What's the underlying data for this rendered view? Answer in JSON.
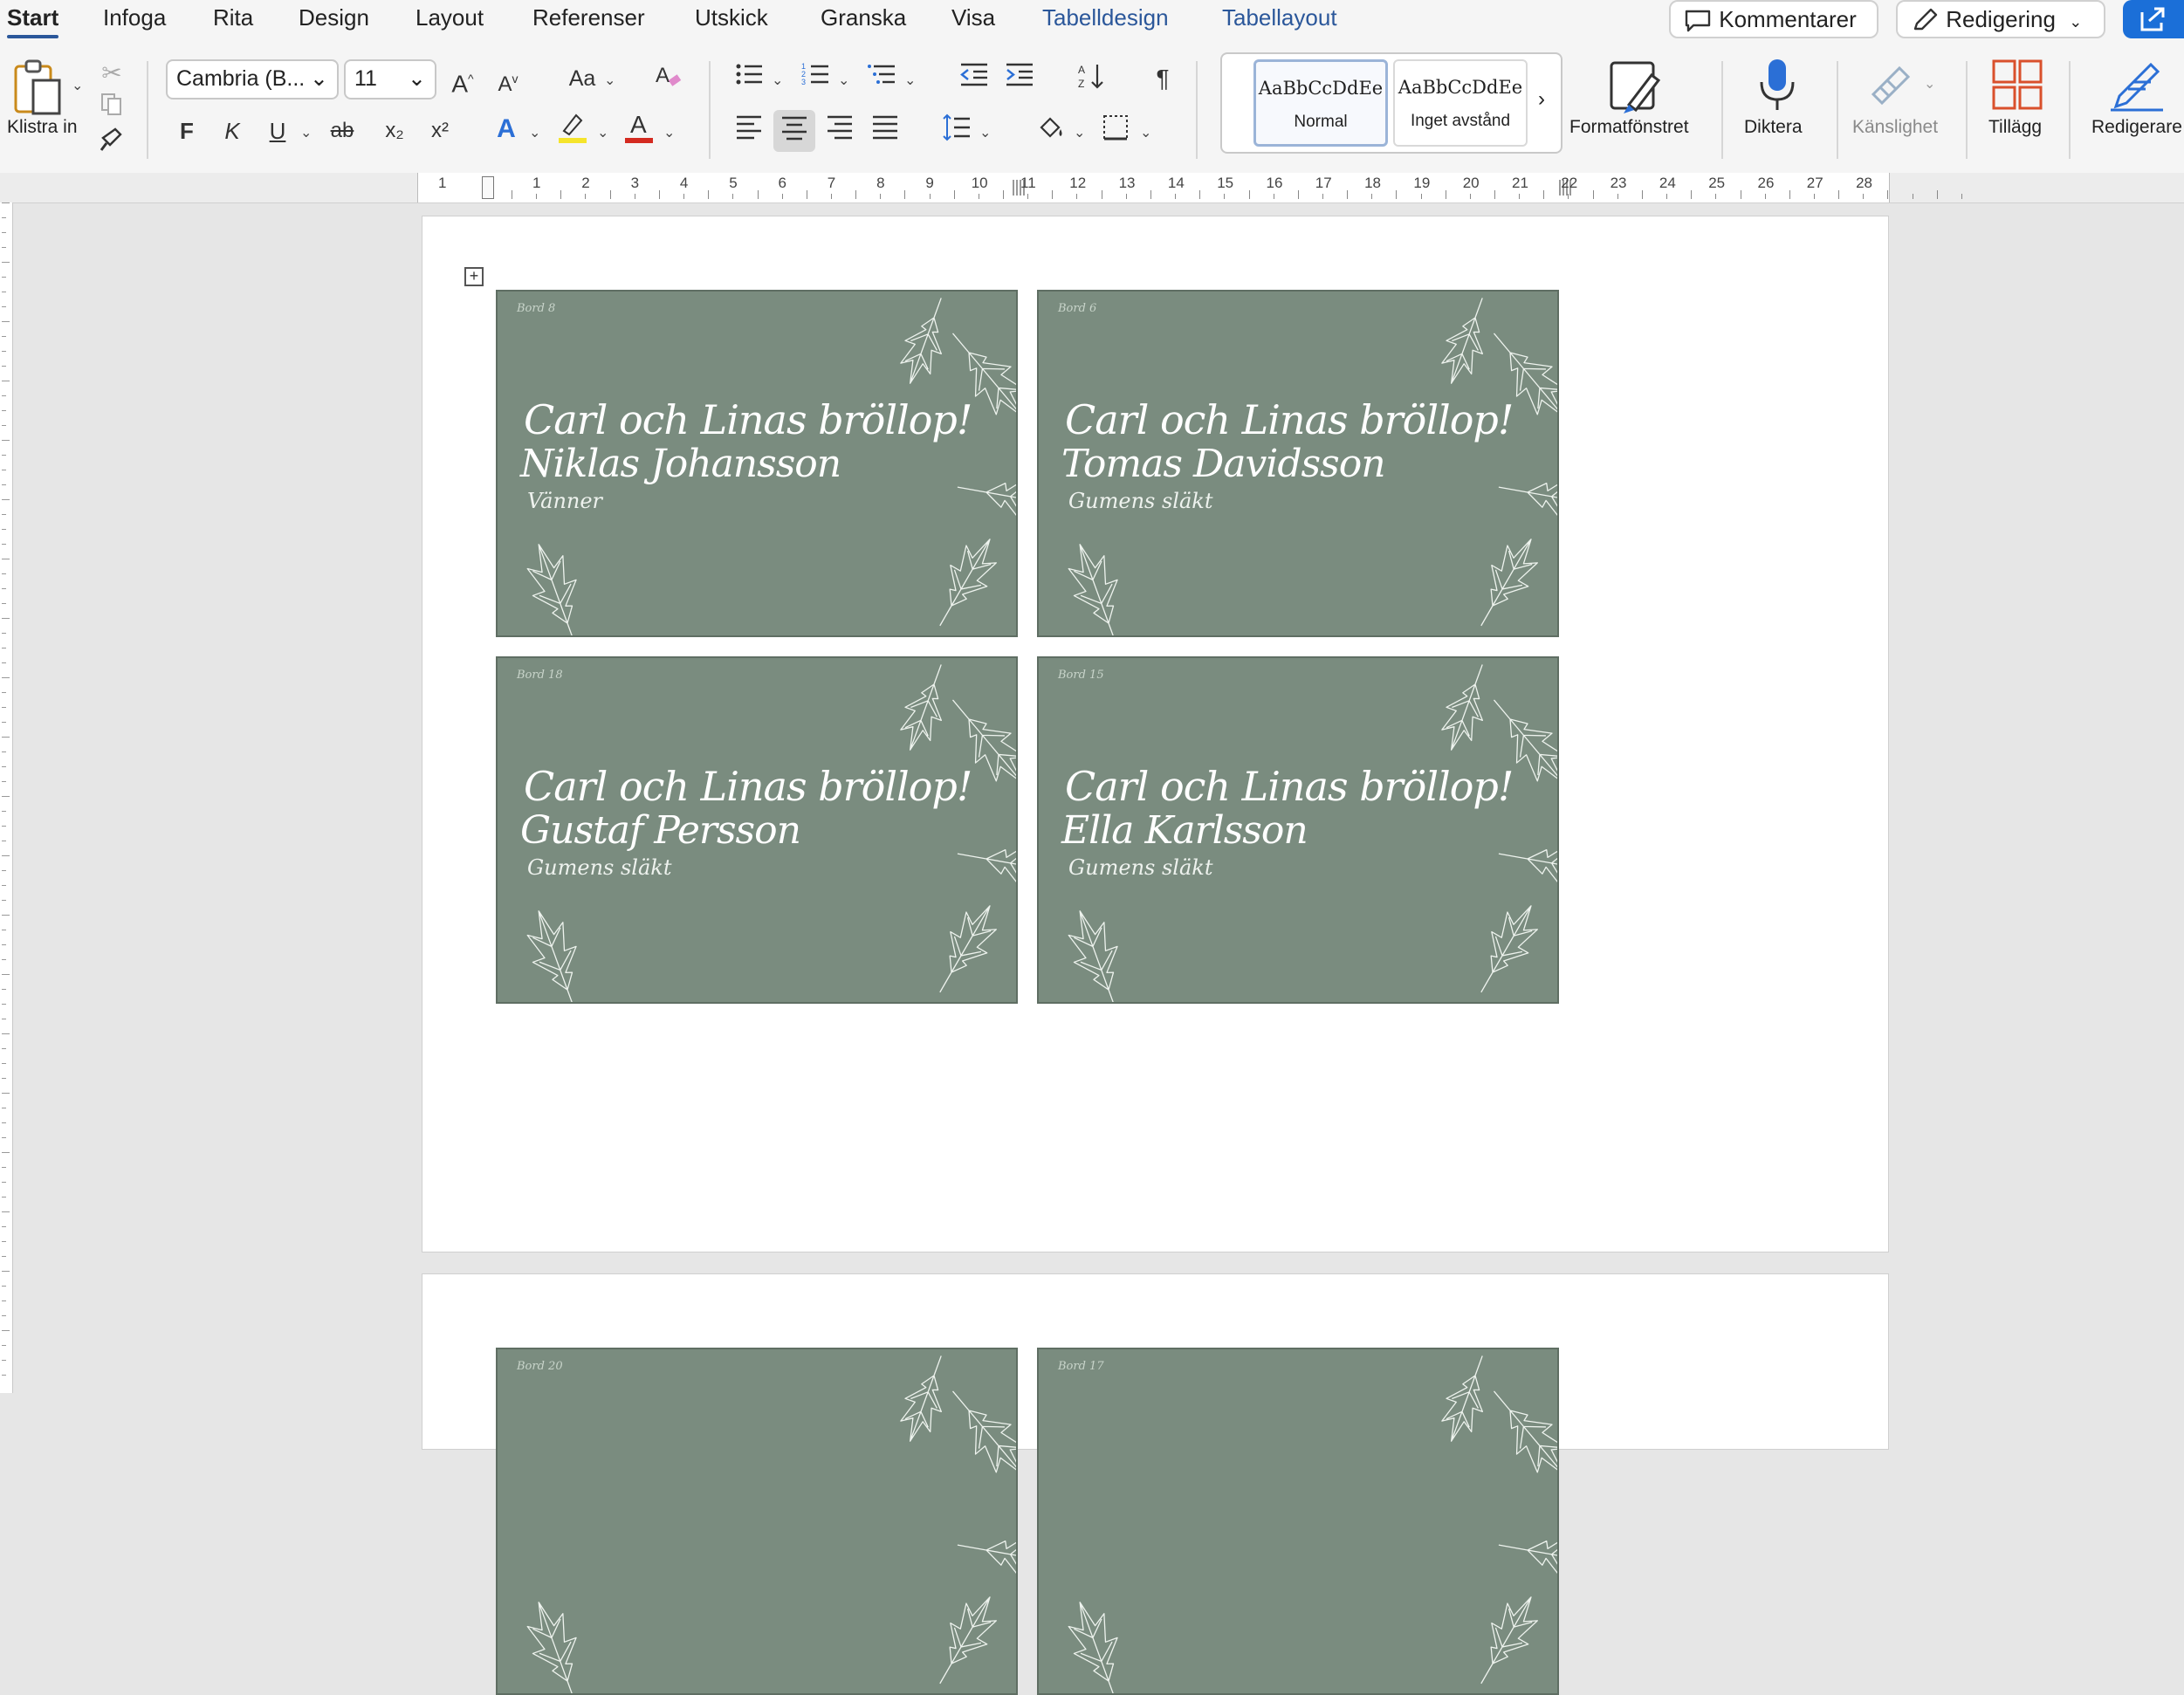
{
  "tabs": [
    {
      "label": "Start",
      "active": true
    },
    {
      "label": "Infoga"
    },
    {
      "label": "Rita"
    },
    {
      "label": "Design"
    },
    {
      "label": "Layout"
    },
    {
      "label": "Referenser"
    },
    {
      "label": "Utskick"
    },
    {
      "label": "Granska"
    },
    {
      "label": "Visa"
    },
    {
      "label": "Tabelldesign",
      "contextual": true
    },
    {
      "label": "Tabellayout",
      "contextual": true
    }
  ],
  "topright": {
    "comments_label": "Kommentarer",
    "editing_label": "Redigering"
  },
  "ribbon": {
    "paste_label": "Klistra in",
    "font_name": "Cambria (B...",
    "font_size": "11",
    "bold_glyph": "F",
    "italic_glyph": "K",
    "underline_glyph": "U",
    "strike_glyph": "ab",
    "subscript_glyph": "x₂",
    "superscript_glyph": "x²",
    "case_glyph": "Aa",
    "styles": [
      {
        "sample": "AaBbCcDdEe",
        "name": "Normal",
        "selected": true
      },
      {
        "sample": "AaBbCcDdEe",
        "name": "Inget avstånd"
      }
    ],
    "style_pane_label": "Formatfönstret",
    "dictate_label": "Diktera",
    "sensitivity_label": "Känslighet",
    "addins_label": "Tillägg",
    "editor_label": "Redigerare",
    "colors": {
      "highlight": "#f5e42b",
      "font_color": "#d42a20",
      "text_effect": "#2b6fd6"
    }
  },
  "ruler": {
    "left_number": "1",
    "numbers": [
      "1",
      "2",
      "3",
      "4",
      "5",
      "6",
      "7",
      "8",
      "9",
      "10",
      "11",
      "12",
      "13",
      "14",
      "15",
      "16",
      "17",
      "18",
      "19",
      "20",
      "21",
      "22",
      "23",
      "24",
      "25",
      "26",
      "27",
      "28"
    ]
  },
  "document": {
    "card_color": "#7a8c7f",
    "cards": [
      {
        "table": "Bord 8",
        "headline": "Carl och Linas bröllop!",
        "guest": "Niklas Johansson",
        "group": "Vänner"
      },
      {
        "table": "Bord 6",
        "headline": "Carl och Linas bröllop!",
        "guest": "Tomas Davidsson",
        "group": "Gumens släkt"
      },
      {
        "table": "Bord 18",
        "headline": "Carl och Linas bröllop!",
        "guest": "Gustaf Persson",
        "group": "Gumens släkt"
      },
      {
        "table": "Bord 15",
        "headline": "Carl och Linas bröllop!",
        "guest": "Ella Karlsson",
        "group": "Gumens släkt"
      },
      {
        "table": "Bord 20"
      },
      {
        "table": "Bord 17"
      }
    ]
  }
}
